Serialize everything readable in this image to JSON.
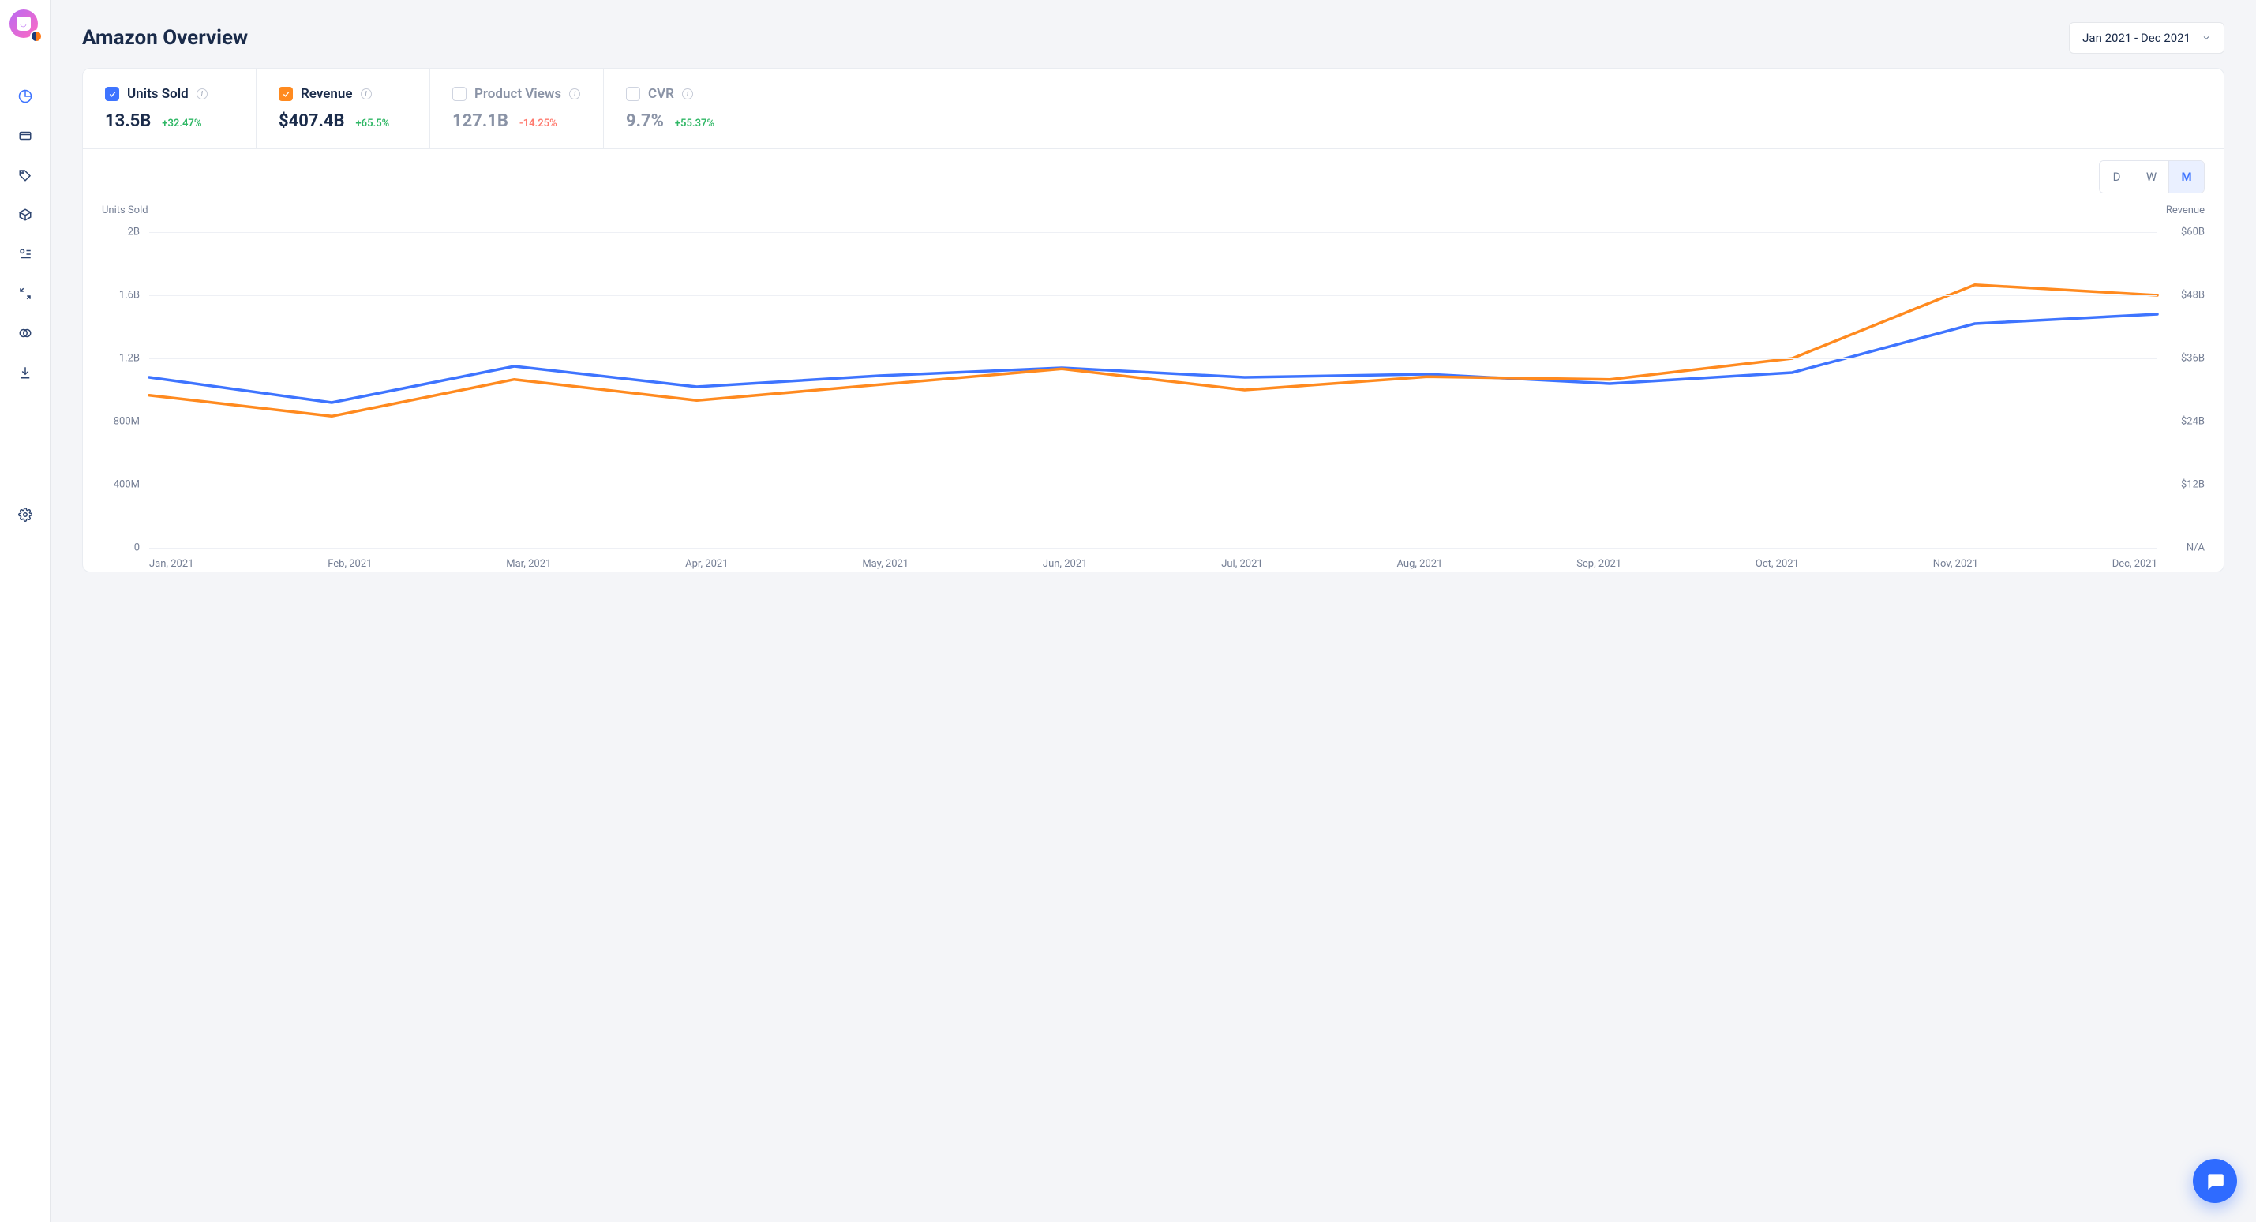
{
  "header": {
    "title": "Amazon Overview",
    "date_range": "Jan 2021 - Dec 2021"
  },
  "nav": {
    "items": [
      "dashboard",
      "card",
      "tag",
      "box",
      "list",
      "compare",
      "venn",
      "download"
    ],
    "footer": "settings"
  },
  "metrics": [
    {
      "key": "units_sold",
      "label": "Units Sold",
      "value": "13.5B",
      "delta": "+32.47%",
      "delta_dir": "pos",
      "checked": true,
      "color": "blue"
    },
    {
      "key": "revenue",
      "label": "Revenue",
      "value": "$407.4B",
      "delta": "+65.5%",
      "delta_dir": "pos",
      "checked": true,
      "color": "orange"
    },
    {
      "key": "product_views",
      "label": "Product Views",
      "value": "127.1B",
      "delta": "-14.25%",
      "delta_dir": "neg",
      "checked": false,
      "color": ""
    },
    {
      "key": "cvr",
      "label": "CVR",
      "value": "9.7%",
      "delta": "+55.37%",
      "delta_dir": "pos",
      "checked": false,
      "color": ""
    }
  ],
  "granularity": {
    "options": [
      "D",
      "W",
      "M"
    ],
    "active": "M"
  },
  "chart_data": {
    "type": "line",
    "title": "",
    "x_labels": [
      "Jan, 2021",
      "Feb, 2021",
      "Mar, 2021",
      "Apr, 2021",
      "May, 2021",
      "Jun, 2021",
      "Jul, 2021",
      "Aug, 2021",
      "Sep, 2021",
      "Oct, 2021",
      "Nov, 2021",
      "Dec, 2021"
    ],
    "left_axis": {
      "label": "Units Sold",
      "ticks": [
        "0",
        "400M",
        "800M",
        "1.2B",
        "1.6B",
        "2B"
      ],
      "range_billions": [
        0,
        2.0
      ]
    },
    "right_axis": {
      "label": "Revenue",
      "ticks": [
        "N/A",
        "$12B",
        "$24B",
        "$36B",
        "$48B",
        "$60B"
      ],
      "range_billions": [
        0,
        60
      ]
    },
    "series": [
      {
        "name": "Units Sold",
        "axis": "left",
        "color": "#3e74ff",
        "unit": "B",
        "values": [
          1.08,
          0.92,
          1.15,
          1.02,
          1.09,
          1.14,
          1.08,
          1.1,
          1.04,
          1.11,
          1.42,
          1.48
        ]
      },
      {
        "name": "Revenue",
        "axis": "right",
        "color": "#ff8a1f",
        "unit": "$B",
        "values": [
          29.0,
          25.0,
          32.0,
          28.0,
          31.0,
          34.0,
          30.0,
          32.5,
          32.0,
          36.0,
          50.0,
          48.0
        ]
      }
    ]
  }
}
